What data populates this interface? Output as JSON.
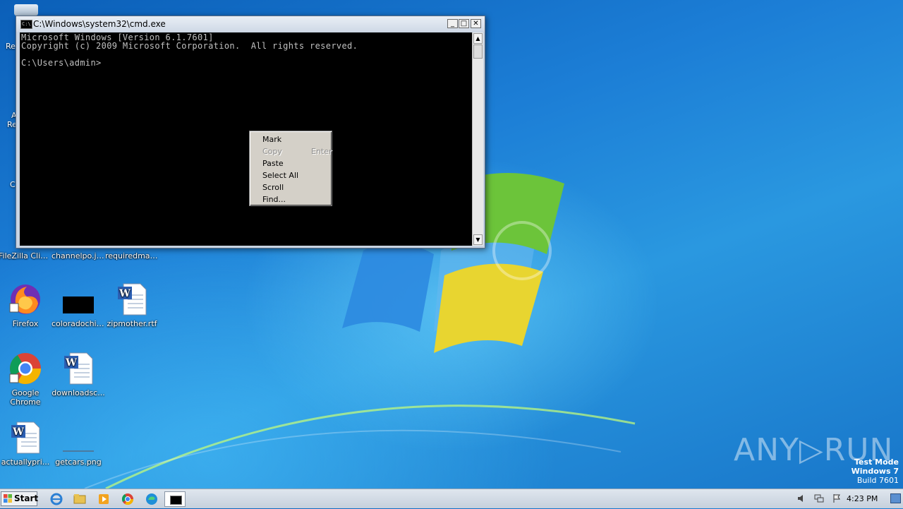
{
  "cmd_window": {
    "title": "C:\\Windows\\system32\\cmd.exe",
    "icon_text": "C:\\",
    "minimize": "_",
    "maximize": "□",
    "close": "✕",
    "lines": [
      "Microsoft Windows [Version 6.1.7601]",
      "Copyright (c) 2009 Microsoft Corporation.  All rights reserved.",
      "",
      "C:\\Users\\admin>"
    ]
  },
  "context_menu": {
    "items": [
      {
        "label": "Mark",
        "shortcut": "",
        "enabled": true
      },
      {
        "label": "Copy",
        "shortcut": "Enter",
        "enabled": false
      },
      {
        "label": "Paste",
        "shortcut": "",
        "enabled": true
      },
      {
        "label": "Select All",
        "shortcut": "",
        "enabled": true
      },
      {
        "label": "Scroll",
        "shortcut": "",
        "enabled": true
      },
      {
        "label": "Find...",
        "shortcut": "",
        "enabled": true
      }
    ]
  },
  "desktop": {
    "partial_labels": [
      "Re",
      "A",
      "Re",
      "C"
    ],
    "icons": [
      {
        "label": "FileZilla Client",
        "icon": "filezilla-icon"
      },
      {
        "label": "channelpo.jpg",
        "icon": "image-icon"
      },
      {
        "label": "requiredmar...",
        "icon": "word-doc-icon"
      },
      {
        "label": "Firefox",
        "icon": "firefox-icon"
      },
      {
        "label": "coloradochil...",
        "icon": "image-icon"
      },
      {
        "label": "zipmother.rtf",
        "icon": "word-doc-icon"
      },
      {
        "label": "Google Chrome",
        "icon": "chrome-icon"
      },
      {
        "label": "downloadsc...",
        "icon": "word-doc-icon"
      },
      {
        "label": "actuallypri...",
        "icon": "word-doc-icon"
      },
      {
        "label": "getcars.png",
        "icon": "image-icon"
      }
    ]
  },
  "taskbar": {
    "start_label": "Start",
    "pinned": [
      "internet-explorer-icon",
      "file-explorer-icon",
      "media-player-icon",
      "chrome-icon",
      "edge-icon",
      "cmd-icon"
    ],
    "clock": "4:23 PM"
  },
  "watermark": {
    "brand": "ANY▷RUN",
    "test_mode": "Test Mode",
    "os": "Windows 7",
    "build": "Build 7601"
  }
}
